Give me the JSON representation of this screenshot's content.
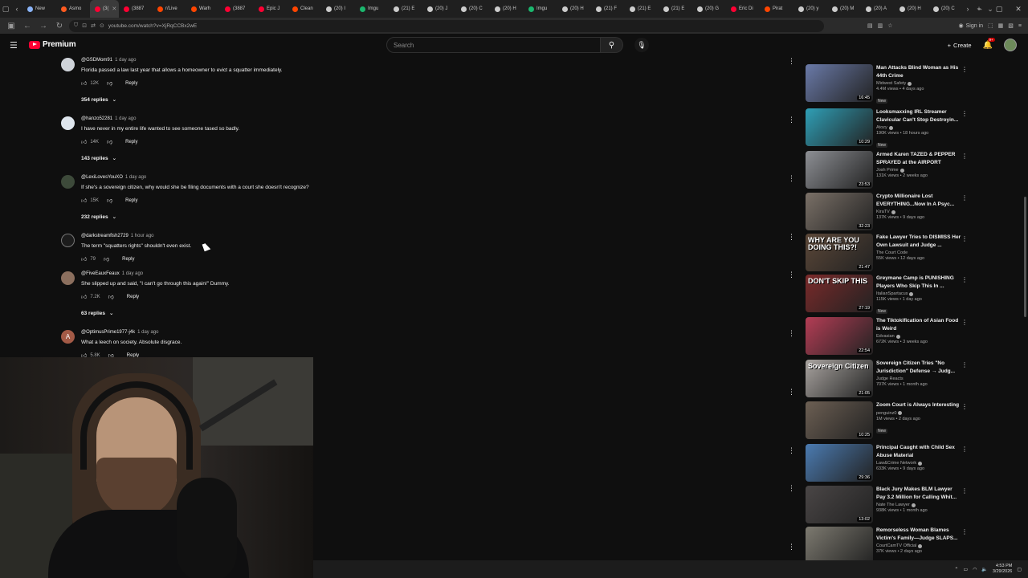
{
  "browser": {
    "tabs": [
      {
        "label": "New",
        "color": "#8ab4f8"
      },
      {
        "label": "Asmo",
        "color": "#ff5a1f"
      },
      {
        "label": "(3(",
        "color": "#ff0033",
        "active": true
      },
      {
        "label": "(3887",
        "color": "#ff0033"
      },
      {
        "label": "r/Live",
        "color": "#ff4500"
      },
      {
        "label": "Warh",
        "color": "#ff4500"
      },
      {
        "label": "(3887",
        "color": "#ff0033"
      },
      {
        "label": "Epic J",
        "color": "#ff0033"
      },
      {
        "label": "Clean",
        "color": "#ff4500"
      },
      {
        "label": "(20) I",
        "color": "#cccccc"
      },
      {
        "label": "Imgu",
        "color": "#1bb76e"
      },
      {
        "label": "(21) E",
        "color": "#cccccc"
      },
      {
        "label": "(20) J",
        "color": "#cccccc"
      },
      {
        "label": "(20) C",
        "color": "#cccccc"
      },
      {
        "label": "(20) H",
        "color": "#cccccc"
      },
      {
        "label": "Imgu",
        "color": "#1bb76e"
      },
      {
        "label": "(20) H",
        "color": "#cccccc"
      },
      {
        "label": "(21) F",
        "color": "#cccccc"
      },
      {
        "label": "(21) E",
        "color": "#cccccc"
      },
      {
        "label": "(21) E",
        "color": "#cccccc"
      },
      {
        "label": "(20) G",
        "color": "#cccccc"
      },
      {
        "label": "Eric Di",
        "color": "#ff0033"
      },
      {
        "label": "Pirat",
        "color": "#ff4500"
      },
      {
        "label": "(20) y",
        "color": "#cccccc"
      },
      {
        "label": "(20) M",
        "color": "#cccccc"
      },
      {
        "label": "(20) A",
        "color": "#cccccc"
      },
      {
        "label": "(20) H",
        "color": "#cccccc"
      },
      {
        "label": "(20) C",
        "color": "#cccccc"
      }
    ],
    "url": "youtube.com/watch?v=XjRqCCBx2wE",
    "sign_in": "Sign in"
  },
  "header": {
    "logo_text": "Premium",
    "search_placeholder": "Search",
    "create_label": "Create",
    "notif_badge": "9+"
  },
  "comments": [
    {
      "user": "@GSDMom91",
      "time": "1 day ago",
      "text": "Florida passed a law last year that allows a homeowner to evict a squatter immediately.",
      "likes": "12K",
      "reply": "Reply",
      "replies": "354 replies",
      "avatar": "#cfd3d9"
    },
    {
      "user": "@hanzo52281",
      "time": "1 day ago",
      "text": "I have never in my entire life wanted to see someone tased so badly.",
      "likes": "14K",
      "reply": "Reply",
      "replies": "143 replies",
      "avatar": "#dfe6ee"
    },
    {
      "user": "@LexiLovesYouXO",
      "time": "1 day ago",
      "text": "If she's a sovereign citizen, why would she be filing documents with a court she doesn't recognize?",
      "likes": "15K",
      "reply": "Reply",
      "replies": "232 replies",
      "avatar": "#3d4a3a"
    },
    {
      "user": "@darkstreamfish2729",
      "time": "1 hour ago",
      "text": "The term \"squatters rights\" shouldn't even exist.",
      "likes": "79",
      "reply": "Reply",
      "replies": "",
      "avatar": "#1c1c1c"
    },
    {
      "user": "@FiveEauxFeaux",
      "time": "1 day ago",
      "text": "She slipped up and said, \"I can't go through this again!\" Dummy.",
      "likes": "7.2K",
      "reply": "Reply",
      "replies": "63 replies",
      "avatar": "#8b6f5e"
    },
    {
      "user": "@OptimusPrime1977-j4k",
      "time": "1 day ago",
      "text": "What a leech on society. Absolute disgrace.",
      "likes": "5.8K",
      "reply": "Reply",
      "replies": "",
      "avatar": "#a35a46",
      "initial": "A"
    }
  ],
  "recommendations": [
    {
      "title": "Man Attacks Blind Woman as His 44th Crime",
      "channel": "Midwest Safety",
      "verified": true,
      "meta": "4.4M views • 4 days ago",
      "new": "New",
      "duration": "16:45",
      "thumb": "#6a7aa8",
      "cap": ""
    },
    {
      "title": "Looksmaxxing IRL Streamer Clavicular Can't Stop Destroyin...",
      "channel": "Atozy",
      "verified": true,
      "meta": "190K views • 18 hours ago",
      "new": "New",
      "duration": "10:29",
      "thumb": "#2f9fb6",
      "cap": ""
    },
    {
      "title": "Armed Karen TAZED & PEPPER SPRAYED at the AIRPORT",
      "channel": "Josh Prime",
      "verified": true,
      "meta": "131K views • 2 weeks ago",
      "new": "",
      "duration": "23:53",
      "thumb": "#8d8f94",
      "cap": ""
    },
    {
      "title": "Crypto Millionaire Lost EVERYTHING...Now In A Psyc...",
      "channel": "KiraTV",
      "verified": true,
      "meta": "137K views • 9 days ago",
      "new": "",
      "duration": "32:23",
      "thumb": "#7a7067",
      "cap": ""
    },
    {
      "title": "Fake Lawyer Tries to DISMISS Her Own Lawsuit and Judge ...",
      "channel": "The Court Code",
      "verified": false,
      "meta": "55K views • 12 days ago",
      "new": "",
      "duration": "21:47",
      "thumb": "#5b4738",
      "cap": "WHY ARE YOU DOING THIS?!"
    },
    {
      "title": "Greymane Camp is PUNISHING Players Who Skip This In ...",
      "channel": "ItalianSpartacus",
      "verified": true,
      "meta": "115K views • 1 day ago",
      "new": "New",
      "duration": "27:19",
      "thumb": "#7a2a2a",
      "cap": "DON'T SKIP THIS"
    },
    {
      "title": "The Tiktokification of Asian Food is Weird",
      "channel": "Edvasian",
      "verified": true,
      "meta": "672K views • 3 weeks ago",
      "new": "",
      "duration": "22:54",
      "thumb": "#b43d55",
      "cap": ""
    },
    {
      "title": "Sovereign Citizen Tries \"No Jurisdiction\" Defense → Judg...",
      "channel": "Judge Reacts",
      "verified": false,
      "meta": "707K views • 1 month ago",
      "new": "",
      "duration": "21:05",
      "thumb": "#a9a4a0",
      "cap": "Sovereign Citizen"
    },
    {
      "title": "Zoom Court is Always Interesting",
      "channel": "penguinz0",
      "verified": true,
      "meta": "1M views • 2 days ago",
      "new": "New",
      "duration": "10:25",
      "thumb": "#6c5f53",
      "cap": ""
    },
    {
      "title": "Principal Caught with Child Sex Abuse Material",
      "channel": "Law&Crime Network",
      "verified": true,
      "meta": "633K views • 9 days ago",
      "new": "",
      "duration": "29:36",
      "thumb": "#4b7bb1",
      "cap": ""
    },
    {
      "title": "Black Jury Makes BLM Lawyer Pay 3.2 Million for Calling Whit...",
      "channel": "Nate The Lawyer",
      "verified": true,
      "meta": "938K views • 1 month ago",
      "new": "",
      "duration": "13:02",
      "thumb": "#4a4646",
      "cap": ""
    },
    {
      "title": "Remorseless Woman Blames Victim's Family—Judge SLAPS...",
      "channel": "CourtCamTV Official",
      "verified": true,
      "meta": "37K views • 2 days ago",
      "new": "",
      "duration": "",
      "thumb": "#7d7a70",
      "cap": ""
    }
  ],
  "taskbar": {
    "time": "4:53 PM",
    "date": "3/29/2026"
  }
}
